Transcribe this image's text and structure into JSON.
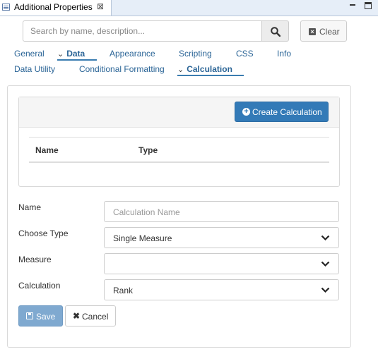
{
  "view": {
    "title": "Additional Properties",
    "close": "⊠"
  },
  "search": {
    "placeholder": "Search by name, description...",
    "clear_label": "Clear"
  },
  "tabs": {
    "general": "General",
    "data": "Data",
    "appearance": "Appearance",
    "scripting": "Scripting",
    "css": "CSS",
    "info": "Info",
    "data_utility": "Data Utility",
    "conditional_formatting": "Conditional Formatting",
    "calculation": "Calculation"
  },
  "calculations": {
    "create_label": "Create Calculation",
    "columns": [
      "Name",
      "Type"
    ]
  },
  "form": {
    "name_label": "Name",
    "name_placeholder": "Calculation Name",
    "type_label": "Choose Type",
    "type_value": "Single Measure",
    "measure_label": "Measure",
    "measure_value": "",
    "calculation_label": "Calculation",
    "calculation_value": "Rank"
  },
  "actions": {
    "save_label": "Save",
    "cancel_label": "Cancel"
  },
  "colors": {
    "primary": "#337ab7",
    "save_disabled": "#7fa9d0",
    "tab_link": "#2a6496"
  }
}
